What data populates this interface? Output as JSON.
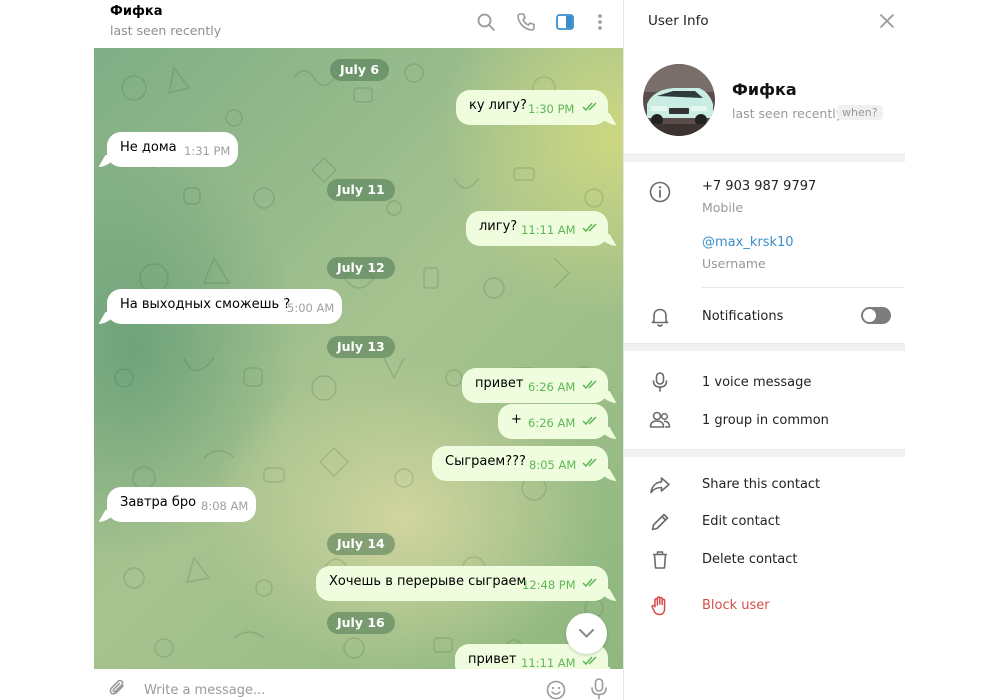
{
  "chat": {
    "name": "Фифка",
    "status": "last seen recently",
    "header_icons": [
      "search-icon",
      "phone-icon",
      "sidebar-panel-icon",
      "more-vertical-icon"
    ]
  },
  "messages": {
    "dates": [
      "July 6",
      "July 11",
      "July 12",
      "July 13",
      "July 14",
      "July 16"
    ],
    "items": [
      {
        "text": "ку лигу?",
        "time": "1:30 PM",
        "dir": "out"
      },
      {
        "text": "Не дома",
        "time": "1:31 PM",
        "dir": "in"
      },
      {
        "text": "лигу?",
        "time": "11:11 AM",
        "dir": "out"
      },
      {
        "text": "На выходных сможешь ?",
        "time": "5:00 AM",
        "dir": "in"
      },
      {
        "text": "привет",
        "time": "6:26 AM",
        "dir": "out"
      },
      {
        "text": "+",
        "time": "6:26 AM",
        "dir": "out"
      },
      {
        "text": "Сыграем???",
        "time": "8:05 AM",
        "dir": "out"
      },
      {
        "text": "Завтра бро",
        "time": "8:08 AM",
        "dir": "in"
      },
      {
        "text": "Хочешь в перерыве сыграем",
        "time": "12:48 PM",
        "dir": "out"
      },
      {
        "text": "привет",
        "time": "11:11 AM",
        "dir": "out"
      }
    ]
  },
  "composer": {
    "placeholder": "Write a message...",
    "icons": [
      "paperclip-icon",
      "emoji-icon",
      "microphone-icon"
    ]
  },
  "info": {
    "title": "User Info",
    "name": "Фифка",
    "status": "last seen recently",
    "when_badge": "when?",
    "phone": "+7 903 987 9797",
    "phone_label": "Mobile",
    "username": "@max_krsk10",
    "username_label": "Username",
    "notifications_label": "Notifications",
    "notifications_on": false,
    "voice_messages": "1 voice message",
    "groups_in_common": "1 group in common",
    "share_contact": "Share this contact",
    "edit_contact": "Edit contact",
    "delete_contact": "Delete contact",
    "block_user": "Block user"
  },
  "colors": {
    "accent": "#3a8ecb",
    "outgoing_bubble": "#effdde",
    "read_ticks": "#5fb656",
    "danger": "#d84b4b",
    "date_pill": "#4e7854"
  }
}
